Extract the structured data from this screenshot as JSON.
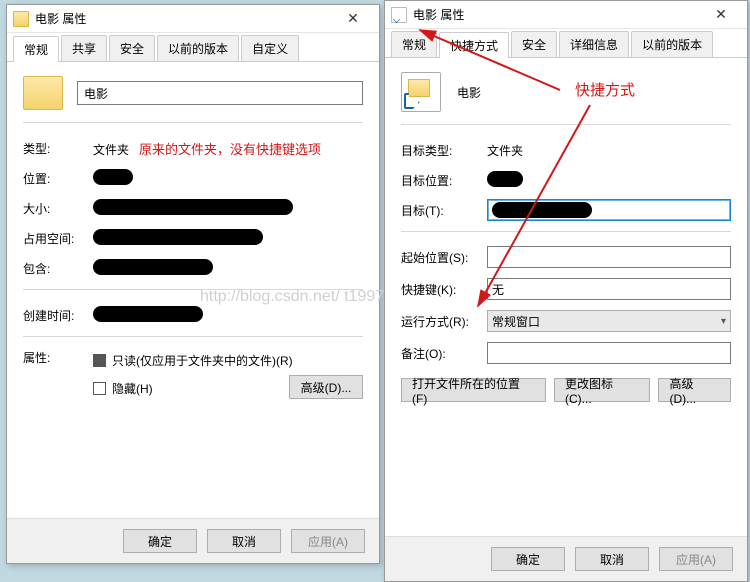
{
  "left": {
    "windowTitle": "电影 属性",
    "tabs": [
      "常规",
      "共享",
      "安全",
      "以前的版本",
      "自定义"
    ],
    "activeTab": 0,
    "name": "电影",
    "labels": {
      "type": "类型:",
      "location": "位置:",
      "size": "大小:",
      "sizeOnDisk": "占用空间:",
      "contains": "包含:",
      "created": "创建时间:",
      "attributes": "属性:"
    },
    "typeValue": "文件夹",
    "readonly": "只读(仅应用于文件夹中的文件)(R)",
    "hidden": "隐藏(H)",
    "advancedBtn": "高级(D)...",
    "annotation": "原来的文件夹，没有快捷键选项",
    "buttons": {
      "ok": "确定",
      "cancel": "取消",
      "apply": "应用(A)"
    }
  },
  "right": {
    "windowTitle": "电影 属性",
    "tabs": [
      "常规",
      "快捷方式",
      "安全",
      "详细信息",
      "以前的版本"
    ],
    "activeTab": 1,
    "name": "电影",
    "labels": {
      "targetType": "目标类型:",
      "targetLoc": "目标位置:",
      "target": "目标(T):",
      "startIn": "起始位置(S):",
      "shortcutKey": "快捷键(K):",
      "run": "运行方式(R):",
      "comment": "备注(O):"
    },
    "targetTypeValue": "文件夹",
    "shortcutKeyValue": "无",
    "runValue": "常规窗口",
    "openLocBtn": "打开文件所在的位置(F)",
    "changeIconBtn": "更改图标(C)...",
    "advancedBtn": "高级(D)...",
    "annotation": "快捷方式",
    "buttons": {
      "ok": "确定",
      "cancel": "取消",
      "apply": "应用(A)"
    }
  },
  "watermark": "http://blog.csdn.net/    t1997"
}
